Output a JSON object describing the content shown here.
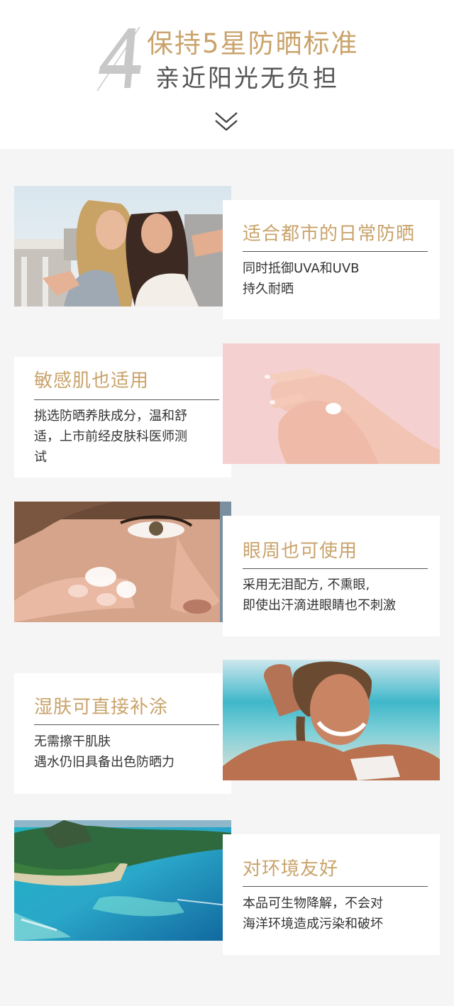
{
  "header": {
    "number": "4",
    "title_line1": "保持5星防晒标准",
    "title_line2": "亲近阳光无负担",
    "scroll_icon": "double-chevron-down-icon"
  },
  "colors": {
    "accent_gold": "#c9a36b",
    "text_dark": "#333333",
    "background": "#f5f5f5"
  },
  "features": [
    {
      "title": "适合都市的日常防晒",
      "line1": "同时抵御UVA和UVB",
      "line2": "持久耐晒",
      "line3": ""
    },
    {
      "title": "敏感肌也适用",
      "line1": "挑选防晒养肤成分，温和舒",
      "line2": "适，上市前经皮肤科医师测",
      "line3": "试"
    },
    {
      "title": "眼周也可使用",
      "line1": "采用无泪配方, 不熏眼,",
      "line2": "即使出汗滴进眼睛也不刺激",
      "line3": ""
    },
    {
      "title": "湿肤可直接补涂",
      "line1": "无需擦干肌肤",
      "line2": "遇水仍旧具备出色防晒力",
      "line3": ""
    },
    {
      "title": "对环境友好",
      "line1": "本品可生物降解，不会对",
      "line2": "海洋环境造成污染和破坏",
      "line3": ""
    }
  ]
}
